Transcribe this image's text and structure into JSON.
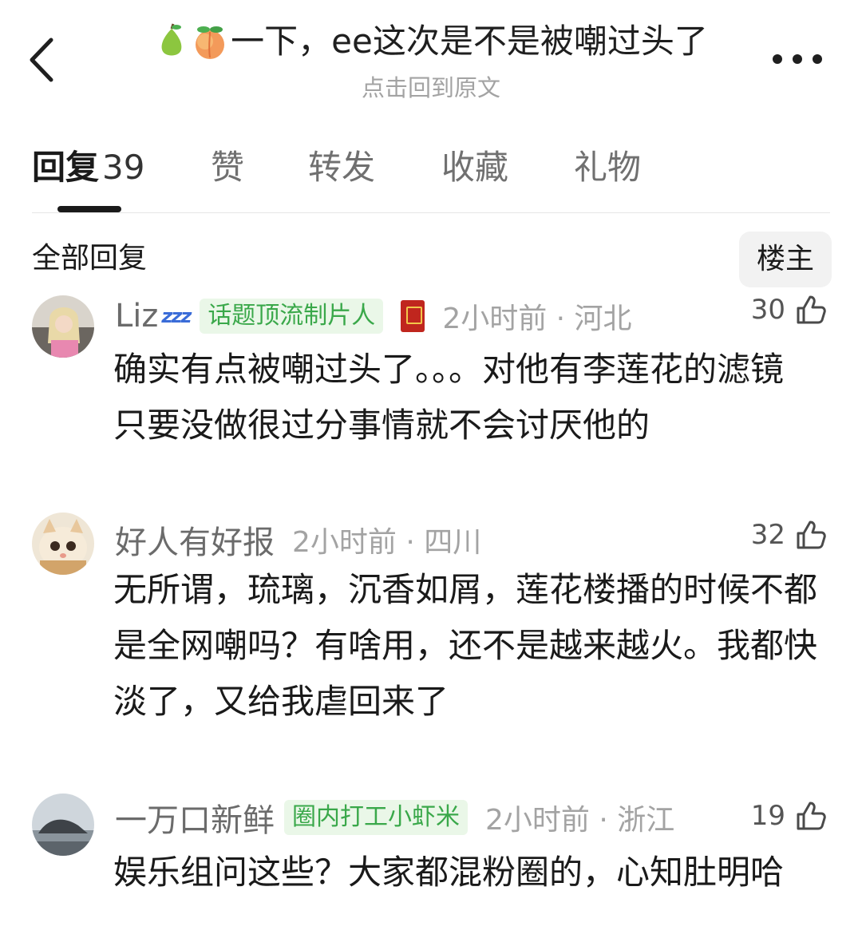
{
  "header": {
    "title": "一下，ee这次是不是被嘲过头了",
    "title_emojis": [
      "pear",
      "peach"
    ],
    "subtitle": "点击回到原文",
    "back_icon": "chevron-left-icon",
    "more_icon": "more-dots-icon"
  },
  "tabs": [
    {
      "label": "回复",
      "count": "39",
      "active": true
    },
    {
      "label": "赞"
    },
    {
      "label": "转发"
    },
    {
      "label": "收藏"
    },
    {
      "label": "礼物"
    }
  ],
  "filter": {
    "label": "全部回复",
    "op_button": "楼主"
  },
  "comments": [
    {
      "username": "Liz",
      "username_suffix": "zzz",
      "badge": "话题顶流制片人",
      "time_location": "2小时前 · 河北",
      "likes": "30",
      "text": "确实有点被嘲过头了。。。对他有李莲花的滤镜 只要没做很过分事情就不会讨厌他的"
    },
    {
      "username": "好人有好报",
      "time_location": "2小时前 · 四川",
      "likes": "32",
      "text": "无所谓，琉璃，沉香如屑，莲花楼播的时候不都是全网嘲吗？有啥用，还不是越来越火。我都快淡了，又给我虐回来了"
    },
    {
      "username": "一万口新鲜",
      "badge": "圈内打工小虾米",
      "time_location": "2小时前 · 浙江",
      "likes": "19",
      "text": "娱乐组问这些？大家都混粉圈的，心知肚明哈"
    }
  ],
  "colors": {
    "badge_bg": "#eaf7e8",
    "badge_text": "#3aa84a",
    "muted": "#a3a3a3"
  }
}
